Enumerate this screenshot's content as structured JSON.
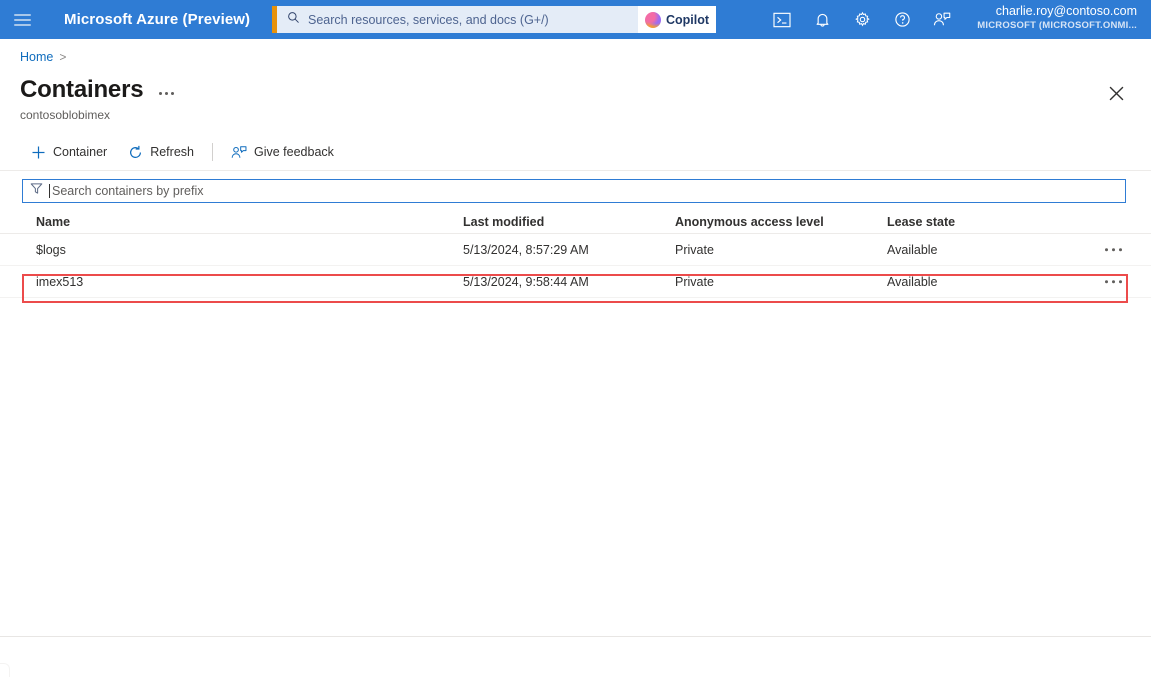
{
  "header": {
    "menu_icon": "hamburger-icon",
    "brand": "Microsoft Azure (Preview)",
    "search": {
      "placeholder": "Search resources, services, and docs (G+/)",
      "value": "",
      "icon": "search-icon",
      "accent_color": "#e8920a"
    },
    "copilot": {
      "label": "Copilot",
      "icon": "copilot-icon"
    },
    "icons": [
      {
        "name": "cloud-shell-icon",
        "title": "Cloud Shell"
      },
      {
        "name": "notifications-bell-icon",
        "title": "Notifications"
      },
      {
        "name": "gear-icon",
        "title": "Settings"
      },
      {
        "name": "help-question-icon",
        "title": "Help"
      },
      {
        "name": "feedback-person-icon",
        "title": "Feedback"
      }
    ],
    "account": {
      "email": "charlie.roy@contoso.com",
      "tenant": "MICROSOFT (MICROSOFT.ONMI..."
    },
    "background_color": "#2f7cd4"
  },
  "breadcrumb": {
    "items": [
      "Home"
    ],
    "separator": ">"
  },
  "page": {
    "title": "Containers",
    "subtitle": "contosoblobimex",
    "more_menu_icon": "ellipsis-icon",
    "close_icon": "close-icon"
  },
  "command_bar": {
    "items": [
      {
        "label": "Container",
        "icon": "plus-icon"
      },
      {
        "label": "Refresh",
        "icon": "refresh-icon"
      },
      {
        "label": "Give feedback",
        "icon": "feedback-person-icon"
      }
    ]
  },
  "filter": {
    "placeholder": "Search containers by prefix",
    "value": "",
    "icon": "filter-funnel-icon"
  },
  "table": {
    "columns": [
      "Name",
      "Last modified",
      "Anonymous access level",
      "Lease state"
    ],
    "rows": [
      {
        "name": "$logs",
        "last_modified": "5/13/2024, 8:57:29 AM",
        "anonymous_access_level": "Private",
        "lease_state": "Available",
        "menu_icon": "row-ellipsis-icon",
        "highlighted": false
      },
      {
        "name": "imex513",
        "last_modified": "5/13/2024, 9:58:44 AM",
        "anonymous_access_level": "Private",
        "lease_state": "Available",
        "menu_icon": "row-ellipsis-icon",
        "highlighted": true
      }
    ],
    "highlight_color": "#ec4b4b"
  }
}
